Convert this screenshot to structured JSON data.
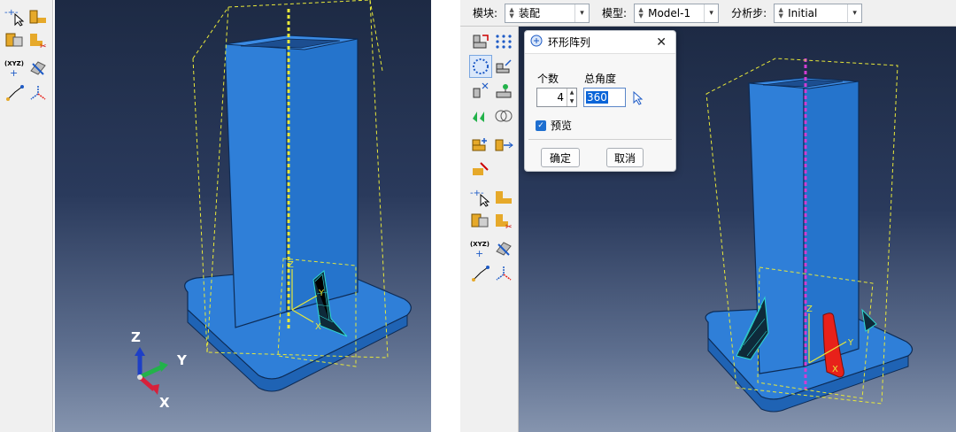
{
  "left": {
    "triad": {
      "z": "Z",
      "y": "Y",
      "x": "X"
    },
    "model_labels": {
      "z": "Z",
      "y": "Y",
      "x": "X"
    }
  },
  "right": {
    "toolbar": {
      "module_label": "模块:",
      "module_value": "装配",
      "model_label": "模型:",
      "model_value": "Model-1",
      "step_label": "分析步:",
      "step_value": "Initial"
    },
    "dialog": {
      "title": "环形阵列",
      "count_label": "个数",
      "angle_label": "总角度",
      "count_value": "4",
      "angle_value": "360",
      "preview_label": "预览",
      "ok_label": "确定",
      "cancel_label": "取消"
    },
    "model_labels": {
      "z": "Z",
      "y": "Y",
      "x": "X"
    }
  },
  "colors": {
    "part_blue": "#2f7fd8",
    "part_dark": "#164a8a",
    "highlight_red": "#e8211a",
    "axis_magenta": "#d23cd2",
    "bbox_yellow": "#e8e83a",
    "mesh_cyan": "#2fd8d0"
  }
}
